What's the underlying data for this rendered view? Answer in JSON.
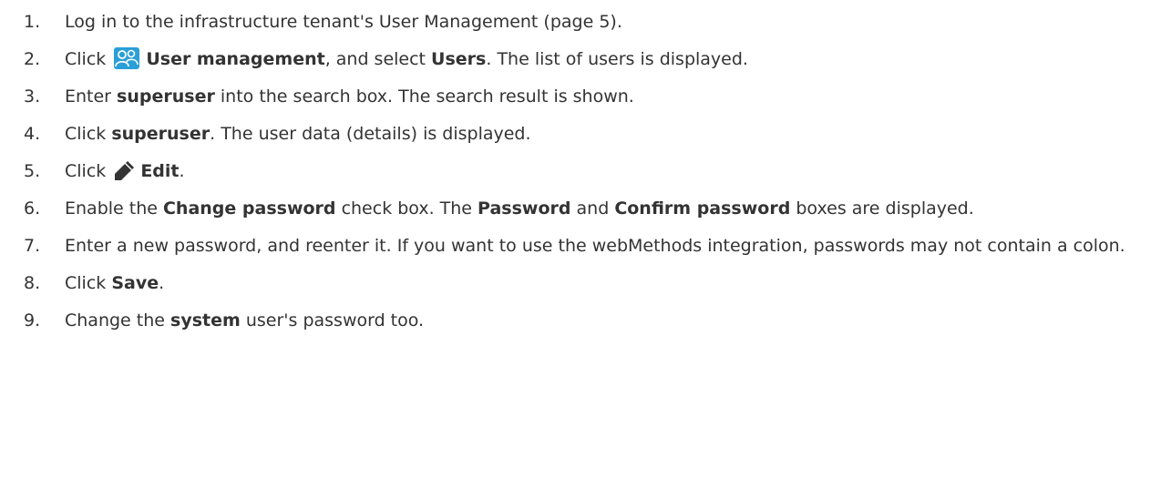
{
  "steps": [
    {
      "number": "1.",
      "segments": [
        {
          "text": "Log in to the infrastructure tenant's User Management (page 5)."
        }
      ]
    },
    {
      "number": "2.",
      "segments": [
        {
          "text": "Click "
        },
        {
          "icon": "users-icon"
        },
        {
          "text": "User management",
          "bold": true
        },
        {
          "text": ", and select "
        },
        {
          "text": "Users",
          "bold": true
        },
        {
          "text": ". The list of users is displayed."
        }
      ]
    },
    {
      "number": "3.",
      "segments": [
        {
          "text": "Enter "
        },
        {
          "text": "superuser",
          "bold": true
        },
        {
          "text": " into the search box. The search result is shown."
        }
      ]
    },
    {
      "number": "4.",
      "segments": [
        {
          "text": "Click "
        },
        {
          "text": "superuser",
          "bold": true
        },
        {
          "text": ". The user data (details) is displayed."
        }
      ]
    },
    {
      "number": "5.",
      "segments": [
        {
          "text": "Click "
        },
        {
          "icon": "pencil-icon"
        },
        {
          "text": "Edit",
          "bold": true
        },
        {
          "text": "."
        }
      ]
    },
    {
      "number": "6.",
      "segments": [
        {
          "text": "Enable the "
        },
        {
          "text": "Change password",
          "bold": true
        },
        {
          "text": " check box. The "
        },
        {
          "text": "Password",
          "bold": true
        },
        {
          "text": " and "
        },
        {
          "text": "Confirm password",
          "bold": true
        },
        {
          "text": " boxes are displayed."
        }
      ]
    },
    {
      "number": "7.",
      "segments": [
        {
          "text": "Enter a new password, and reenter it. If you want to use the webMethods integration, passwords may not contain a colon."
        }
      ]
    },
    {
      "number": "8.",
      "segments": [
        {
          "text": "Click "
        },
        {
          "text": "Save",
          "bold": true
        },
        {
          "text": "."
        }
      ]
    },
    {
      "number": "9.",
      "segments": [
        {
          "text": "Change the "
        },
        {
          "text": "system",
          "bold": true
        },
        {
          "text": " user's password too."
        }
      ]
    }
  ],
  "colors": {
    "text": "#333333",
    "users_icon": "#2a9fd8",
    "pencil_icon": "#333333"
  }
}
